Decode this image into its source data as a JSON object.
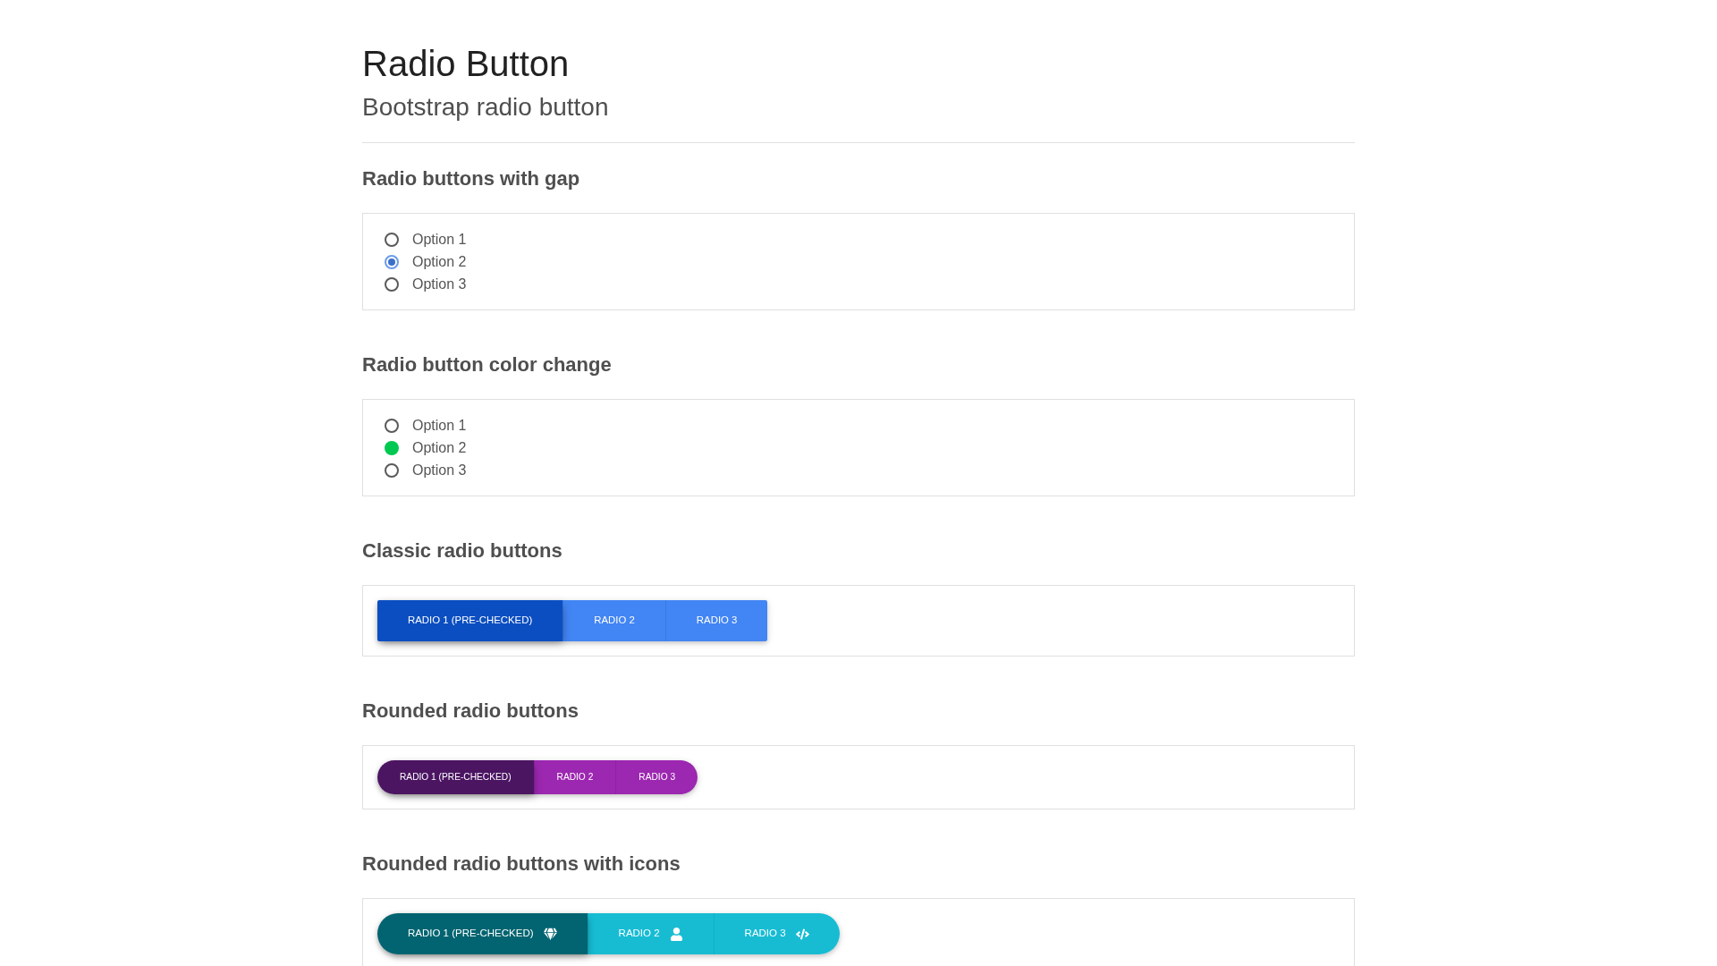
{
  "header": {
    "title": "Radio Button",
    "subtitle": "Bootstrap radio button"
  },
  "sections": [
    {
      "heading": "Radio buttons with gap",
      "kind": "radio-dot",
      "options": [
        {
          "label": "Option 1",
          "selected": false
        },
        {
          "label": "Option 2",
          "selected": true
        },
        {
          "label": "Option 3",
          "selected": false
        }
      ]
    },
    {
      "heading": "Radio button color change",
      "kind": "radio-fill",
      "options": [
        {
          "label": "Option 1",
          "selected": false
        },
        {
          "label": "Option 2",
          "selected": true
        },
        {
          "label": "Option 3",
          "selected": false
        }
      ]
    },
    {
      "heading": "Classic radio buttons",
      "kind": "buttons-square",
      "options": [
        {
          "label": "RADIO 1 (PRE-CHECKED)",
          "selected": true
        },
        {
          "label": "RADIO 2",
          "selected": false
        },
        {
          "label": "RADIO 3",
          "selected": false
        }
      ]
    },
    {
      "heading": "Rounded radio buttons",
      "kind": "buttons-pill",
      "options": [
        {
          "label": "RADIO 1 (PRE-CHECKED)",
          "selected": true
        },
        {
          "label": "RADIO 2",
          "selected": false
        },
        {
          "label": "RADIO 3",
          "selected": false
        }
      ]
    },
    {
      "heading": "Rounded radio buttons with icons",
      "kind": "buttons-pill-icons",
      "options": [
        {
          "label": "RADIO 1 (PRE-CHECKED)",
          "selected": true
        },
        {
          "label": "RADIO 2",
          "selected": false
        },
        {
          "label": "RADIO 3",
          "selected": false
        }
      ]
    }
  ]
}
